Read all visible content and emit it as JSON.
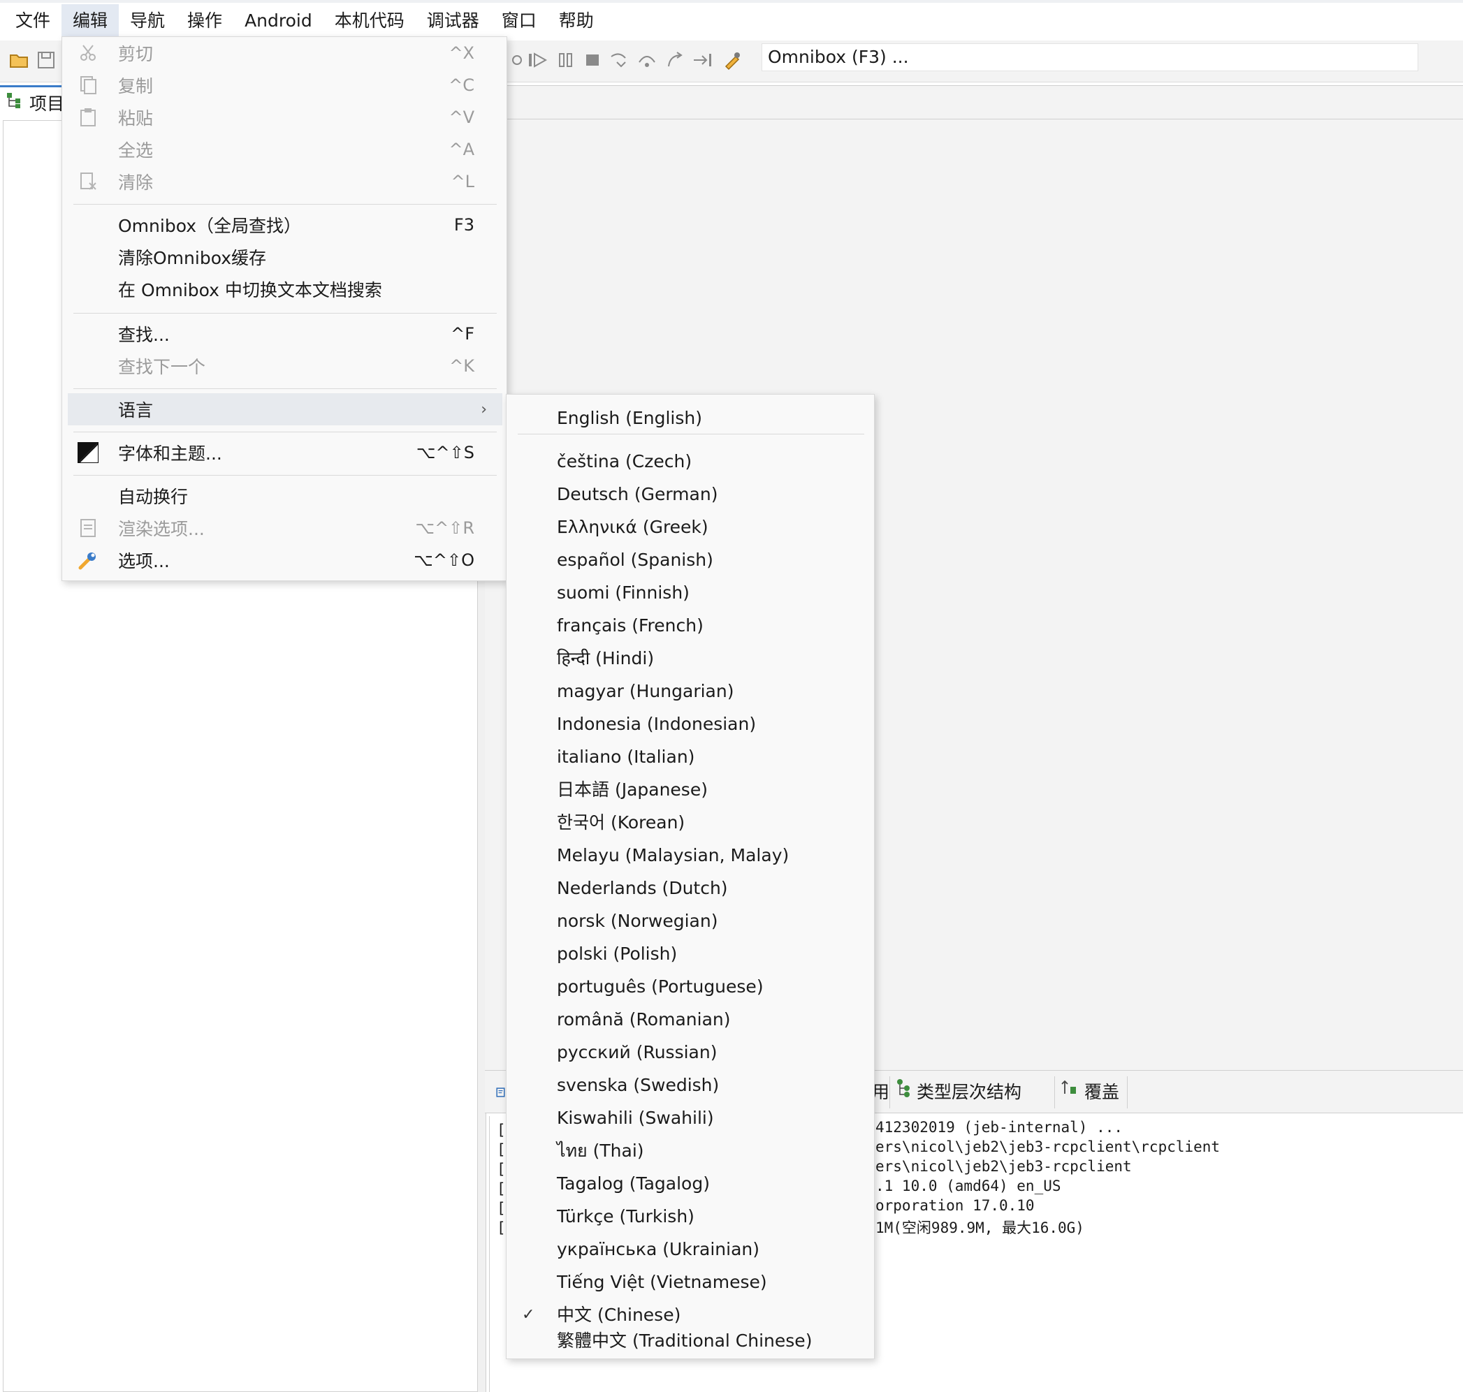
{
  "menubar": {
    "items": [
      "文件",
      "编辑",
      "导航",
      "操作",
      "Android",
      "本机代码",
      "调试器",
      "窗口",
      "帮助"
    ]
  },
  "toolbar": {
    "omnibox_text": "Omnibox (F3) ..."
  },
  "left_panel": {
    "tab_label": "项目"
  },
  "edit_menu": {
    "items": [
      {
        "label": "剪切",
        "shortcut": "^X",
        "icon": "scissors-icon",
        "enabled": false
      },
      {
        "label": "复制",
        "shortcut": "^C",
        "icon": "copy-icon",
        "enabled": false
      },
      {
        "label": "粘贴",
        "shortcut": "^V",
        "icon": "paste-icon",
        "enabled": false
      },
      {
        "label": "全选",
        "shortcut": "^A",
        "icon": "",
        "enabled": false
      },
      {
        "label": "清除",
        "shortcut": "^L",
        "icon": "clear-icon",
        "enabled": false
      },
      {
        "label": "Omnibox（全局查找）",
        "shortcut": "F3",
        "icon": "",
        "enabled": true
      },
      {
        "label": "清除Omnibox缓存",
        "shortcut": "",
        "icon": "",
        "enabled": true
      },
      {
        "label": "在 Omnibox 中切换文本文档搜索",
        "shortcut": "",
        "icon": "",
        "enabled": true
      },
      {
        "label": "查找...",
        "shortcut": "^F",
        "icon": "",
        "enabled": true
      },
      {
        "label": "查找下一个",
        "shortcut": "^K",
        "icon": "",
        "enabled": false
      },
      {
        "label": "语言",
        "shortcut": "",
        "icon": "",
        "enabled": true
      },
      {
        "label": "字体和主题...",
        "shortcut": "⌥^⇧S",
        "icon": "theme-icon",
        "enabled": true
      },
      {
        "label": "自动换行",
        "shortcut": "",
        "icon": "",
        "enabled": true
      },
      {
        "label": "渲染选项...",
        "shortcut": "⌥^⇧R",
        "icon": "render-options-icon",
        "enabled": false
      },
      {
        "label": "选项...",
        "shortcut": "⌥^⇧O",
        "icon": "wrench-icon",
        "enabled": true
      }
    ]
  },
  "language_menu": {
    "selected": "中文 (Chinese)",
    "items": [
      "English (English)",
      "čeština (Czech)",
      "Deutsch (German)",
      "Ελληνικά (Greek)",
      "español (Spanish)",
      "suomi (Finnish)",
      "français (French)",
      "हिन्दी (Hindi)",
      "magyar (Hungarian)",
      "Indonesia (Indonesian)",
      "italiano (Italian)",
      "日本語 (Japanese)",
      "한국어 (Korean)",
      "Melayu (Malaysian, Malay)",
      "Nederlands (Dutch)",
      "norsk (Norwegian)",
      "polski (Polish)",
      "português (Portuguese)",
      "română (Romanian)",
      "русский (Russian)",
      "svenska (Swedish)",
      "Kiswahili (Swahili)",
      "ไทย (Thai)",
      "Tagalog (Tagalog)",
      "Türkçe (Turkish)",
      "українська (Ukrainian)",
      "Tiếng Việt (Vietnamese)",
      "中文 (Chinese)",
      "繁體中文 (Traditional Chinese)"
    ]
  },
  "console": {
    "tabs": [
      "用",
      "类型层次结构",
      "覆盖"
    ],
    "lines": [
      "412302019 (jeb-internal) ...",
      "ers\\nicol\\jeb2\\jeb3-rcpclient\\rcpclient",
      "ers\\nicol\\jeb2\\jeb3-rcpclient",
      ".1 10.0 (amd64) en_US",
      "orporation 17.0.10",
      "1M(空闲989.9M, 最大16.0G)"
    ],
    "bracket": "["
  }
}
